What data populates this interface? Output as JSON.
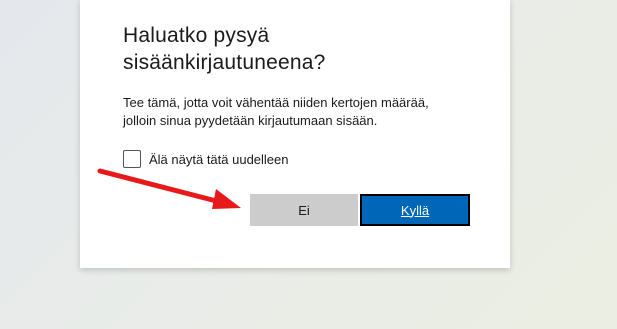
{
  "dialog": {
    "title_line1": "Haluatko pysyä",
    "title_line2": "sisäänkirjautuneena?",
    "description_line1": "Tee tämä, jotta voit vähentää niiden kertojen määrää,",
    "description_line2": "jolloin sinua pyydetään kirjautumaan sisään.",
    "checkbox_label": "Älä näytä tätä uudelleen",
    "checkbox_checked": false,
    "no_label": "Ei",
    "yes_label": "Kyllä"
  },
  "colors": {
    "primary": "#0067b8",
    "secondary": "#cccccc",
    "arrow": "#e8191b"
  }
}
